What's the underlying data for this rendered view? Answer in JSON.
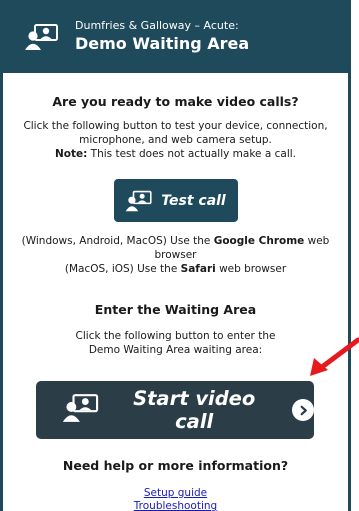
{
  "header": {
    "subtitle": "Dumfries & Galloway – Acute:",
    "title": "Demo Waiting Area",
    "icon": "video-call-icon"
  },
  "test_section": {
    "heading": "Are you ready to make video calls?",
    "line1": "Click the following button to test your device, connection,",
    "line2": "microphone, and web camera setup.",
    "note_label": "Note:",
    "note_text": " This test does not actually make a call.",
    "button_label": "Test call"
  },
  "browsers": {
    "line1_pre": "(Windows, Android, MacOS) Use the ",
    "line1_bold": "Google Chrome",
    "line1_post": " web browser",
    "line2_pre": "(MacOS, iOS) Use the ",
    "line2_bold": "Safari",
    "line2_post": " web browser"
  },
  "waiting_section": {
    "heading": "Enter the Waiting Area",
    "line1": "Click the following button to enter the",
    "line2": "Demo Waiting Area waiting area:",
    "button_label": "Start video call"
  },
  "help_section": {
    "heading": "Need help or more information?",
    "link1": "Setup guide",
    "link2": "Troubleshooting"
  },
  "colors": {
    "header_bg": "#1f4a5c",
    "start_button_bg": "#2b3e47",
    "annotation_arrow": "#e8191c",
    "link": "#1a1ab5"
  }
}
